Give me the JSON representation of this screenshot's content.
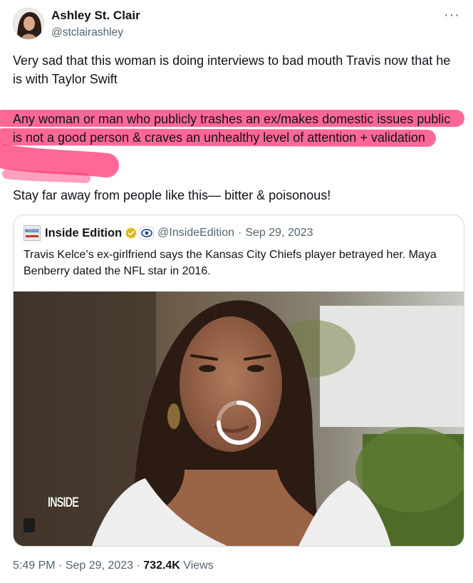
{
  "author": {
    "name": "Ashley St. Clair",
    "handle": "@stclairashley"
  },
  "tweet": {
    "paragraphs": [
      "Very sad that this woman is doing interviews to bad mouth Travis now that he is with Taylor Swift",
      "Any woman or man who publicly trashes an ex/makes domestic issues public is not a good person & craves an unhealthy level of attention + validation",
      "Stay far away from people like this— bitter & poisonous!"
    ],
    "highlight_color": "#ff2e6e"
  },
  "quoted": {
    "logo_text": "INSIDE",
    "account_name": "Inside Edition",
    "handle": "@InsideEdition",
    "separator": "·",
    "date": "Sep 29, 2023",
    "text": "Travis Kelce’s ex-girlfriend says the Kansas City Chiefs player betrayed her. Maya Benberry dated the NFL star in 2016.",
    "media_watermark": "INSIDE",
    "verified_badge_color": "#e2b719",
    "icons": [
      "verified-badge-icon",
      "affiliate-eye-icon",
      "loading-spinner-icon",
      "more-options-icon"
    ]
  },
  "footer": {
    "time": "5:49 PM",
    "separator": "·",
    "date": "Sep 29, 2023",
    "views_count": "732.4K",
    "views_label": "Views"
  }
}
